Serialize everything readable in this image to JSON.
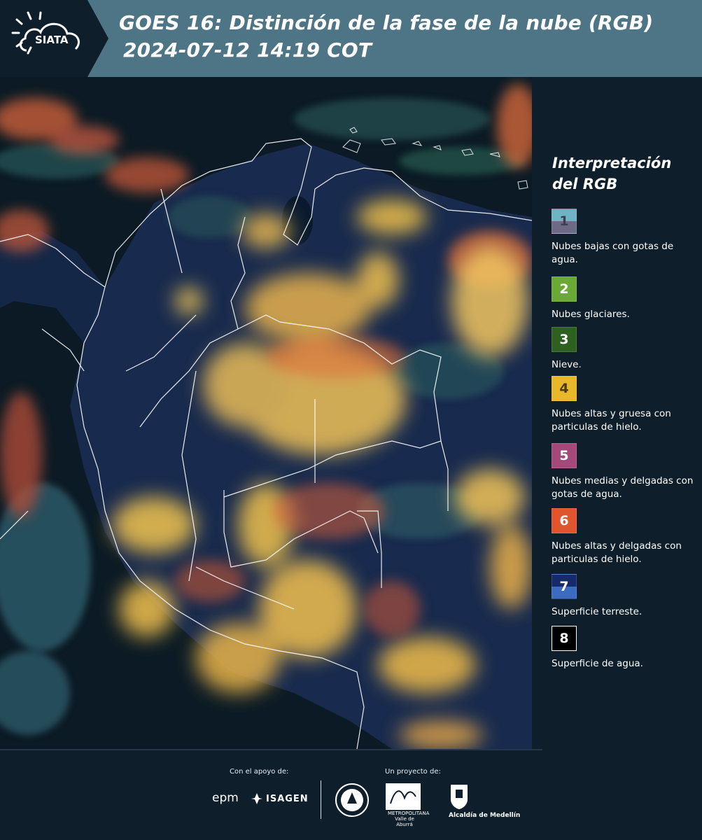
{
  "header": {
    "logo_text": "SIATA",
    "title_line1": "GOES 16: Distinción de la fase de la nube (RGB)",
    "title_line2": "2024-07-12 14:19 COT"
  },
  "legend": {
    "title": "Interpretación del RGB",
    "items": [
      {
        "number": "1",
        "label": "Nubes bajas con gotas de agua.",
        "top_color": "#6fb4c4",
        "bottom_color": "#6e6a86",
        "number_color": "#3a3f52"
      },
      {
        "number": "2",
        "label": "Nubes glaciares.",
        "top_color": "#6aaa34",
        "bottom_color": "#6aaa34",
        "number_color": "#ffffff"
      },
      {
        "number": "3",
        "label": "Nieve.",
        "top_color": "#2e6020",
        "bottom_color": "#2e6020",
        "number_color": "#ffffff"
      },
      {
        "number": "4",
        "label": "Nubes altas y gruesa con particulas de hielo.",
        "top_color": "#e8b82a",
        "bottom_color": "#e8b82a",
        "number_color": "#4a3a10"
      },
      {
        "number": "5",
        "label": "Nubes medias y delgadas con gotas de agua.",
        "top_color": "#a44a7a",
        "bottom_color": "#a44a7a",
        "number_color": "#ffffff"
      },
      {
        "number": "6",
        "label": "Nubes altas y delgadas con particulas de hielo.",
        "top_color": "#e0552e",
        "bottom_color": "#e0552e",
        "number_color": "#ffffff"
      },
      {
        "number": "7",
        "label": "Superficie terreste.",
        "top_color": "#162a6a",
        "bottom_color": "#3c6cc0",
        "number_color": "#ffffff"
      },
      {
        "number": "8",
        "label": "Superficie de agua.",
        "top_color": "#000000",
        "bottom_color": "#000000",
        "number_color": "#ffffff"
      }
    ]
  },
  "footer": {
    "support_label": "Con el apoyo de:",
    "project_label": "Un proyecto de:",
    "epm": "epm",
    "isagen": "ISAGEN",
    "amva_text": "METROPOLITANA Valle de Aburrá",
    "alcaldia": "Alcaldía de Medellín"
  },
  "colors": {
    "header_bg": "#4e7585",
    "panel_bg": "#0e1e2a",
    "cloud_yellow": "#f2c24a",
    "cloud_orange": "#e8703a",
    "border_white": "#ffffff"
  }
}
